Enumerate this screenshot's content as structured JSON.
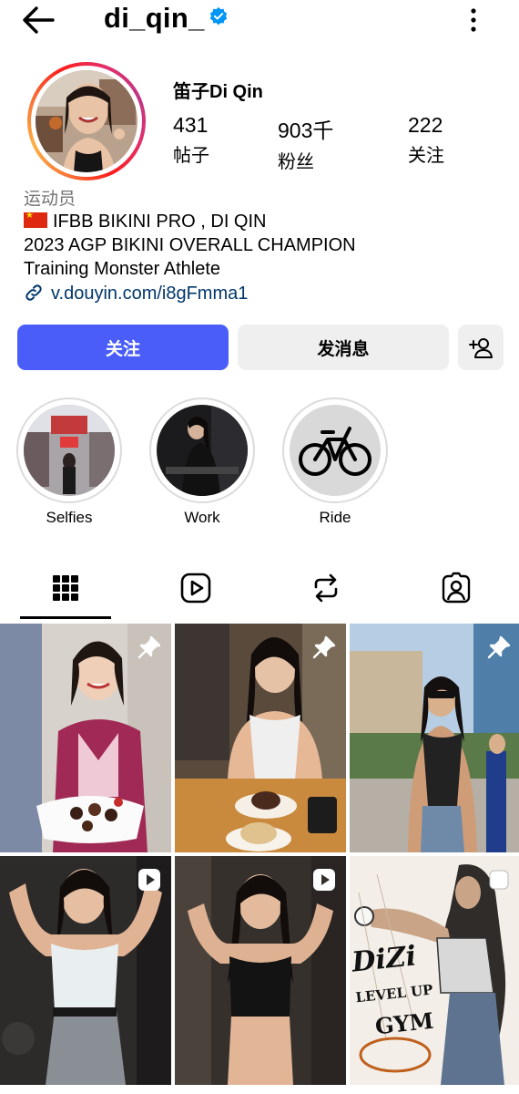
{
  "header": {
    "username": "di_qin_",
    "back_icon": "arrow-left-icon",
    "verified_icon": "verified-badge-icon",
    "more_icon": "more-vertical-icon"
  },
  "profile": {
    "display_name": "笛子Di Qin",
    "stats": [
      {
        "value": "431",
        "label": "帖子"
      },
      {
        "value": "903千",
        "label": "粉丝"
      },
      {
        "value": "222",
        "label": "关注"
      }
    ],
    "category": "运动员",
    "bio": {
      "line1": "IFBB BIKINI PRO , DI QIN",
      "line2": "2023 AGP BIKINI OVERALL CHAMPION",
      "line3": "Training Monster Athlete"
    },
    "link": "v.douyin.com/i8gFmma1"
  },
  "actions": {
    "follow_label": "关注",
    "message_label": "发消息",
    "add_user_icon": "add-person-icon"
  },
  "highlights": [
    {
      "label": "Selfies"
    },
    {
      "label": "Work"
    },
    {
      "label": "Ride"
    }
  ],
  "tabs": [
    "grid-icon",
    "reels-icon",
    "reposts-icon",
    "tagged-icon"
  ],
  "colors": {
    "follow_button": "#4a5df9",
    "secondary_button": "#efefef",
    "link": "#00376b",
    "category_text": "#737373",
    "verified": "#0095f6"
  },
  "posts": [
    {
      "badge": "pin-icon"
    },
    {
      "badge": "pin-icon"
    },
    {
      "badge": "pin-icon"
    },
    {
      "badge": "video-icon"
    },
    {
      "badge": "video-icon"
    },
    {
      "badge": "carousel-icon",
      "art_text": [
        "DiZi",
        "LEVEL UP",
        "GYM"
      ]
    }
  ]
}
